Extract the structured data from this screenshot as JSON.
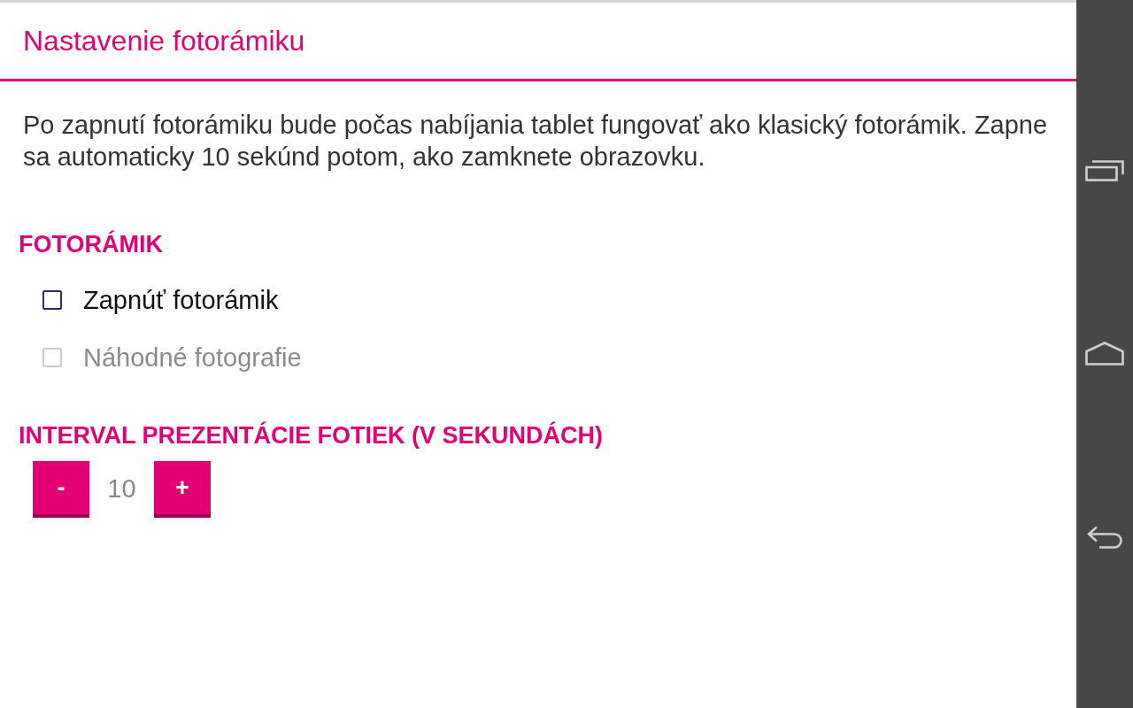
{
  "header": {
    "title": "Nastavenie fotorámiku"
  },
  "description": "Po zapnutí fotorámiku bude počas nabíjania tablet fungovať ako klasický fotorámik. Zapne sa automaticky 10 sekúnd potom, ako zamknete obrazovku.",
  "sections": [
    {
      "kind": "checkboxes",
      "heading": "FOTORÁMIK",
      "options": [
        {
          "label": "Zapnúť fotorámik",
          "checked": false,
          "disabled": false
        },
        {
          "label": "Náhodné fotografie",
          "checked": false,
          "disabled": true
        }
      ]
    },
    {
      "kind": "stepper",
      "heading": "INTERVAL PREZENTÁCIE FOTIEK (V SEKUNDÁCH)",
      "decrement": "-",
      "value": "10",
      "increment": "+"
    }
  ]
}
